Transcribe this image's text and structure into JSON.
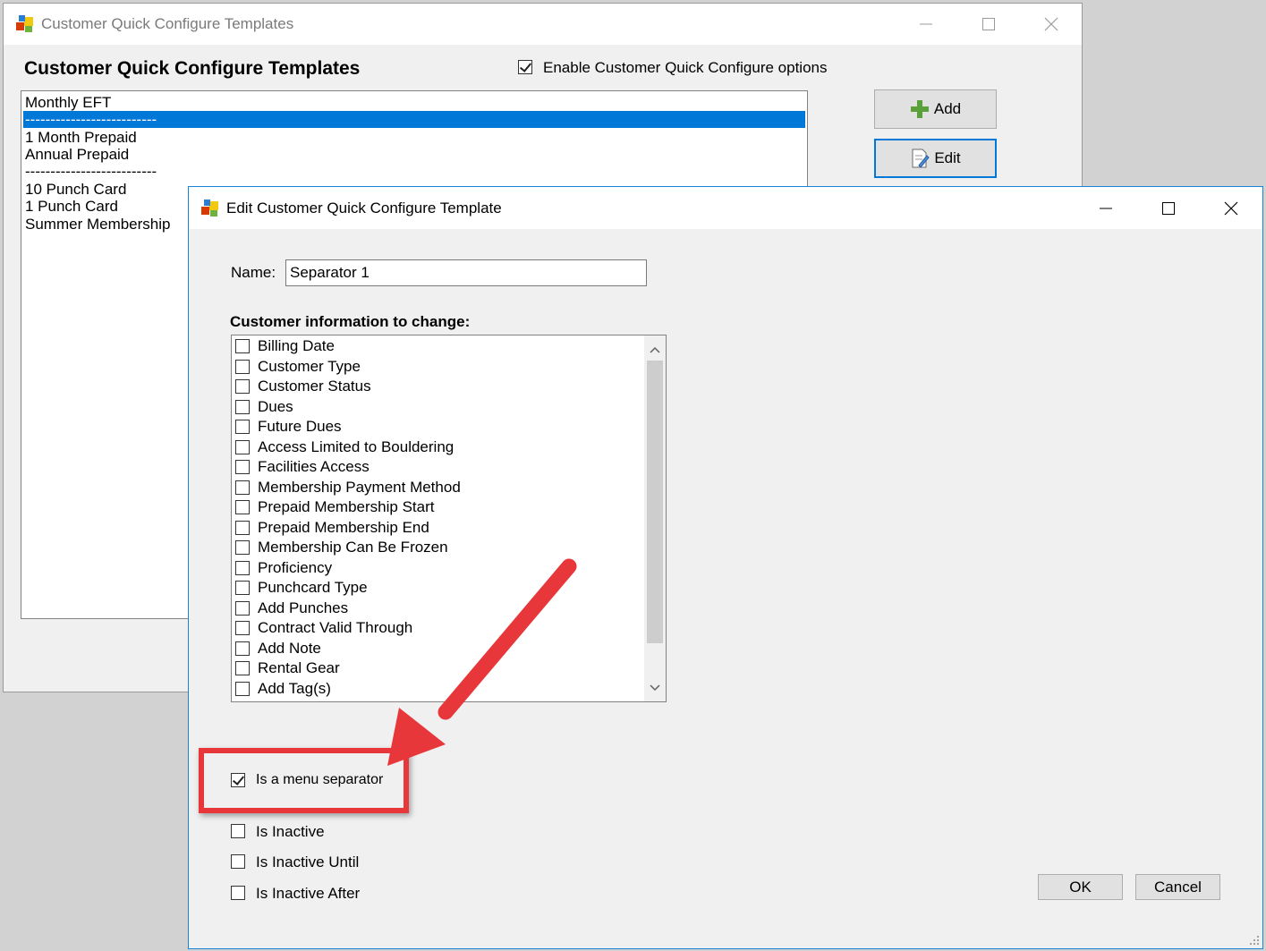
{
  "back_window": {
    "title": "Customer Quick Configure Templates",
    "heading": "Customer Quick Configure Templates",
    "enable_option": {
      "label": "Enable Customer Quick Configure options",
      "checked": true
    },
    "template_list": [
      {
        "text": "Monthly EFT",
        "selected": false
      },
      {
        "text": "--------------------------",
        "selected": true
      },
      {
        "text": "1 Month Prepaid",
        "selected": false
      },
      {
        "text": "Annual Prepaid",
        "selected": false
      },
      {
        "text": "--------------------------",
        "selected": false
      },
      {
        "text": "10 Punch Card",
        "selected": false
      },
      {
        "text": "1 Punch Card",
        "selected": false
      },
      {
        "text": "Summer Membership",
        "selected": false
      }
    ],
    "add_label": "Add",
    "edit_label": "Edit"
  },
  "dialog": {
    "title": "Edit Customer Quick Configure Template",
    "name_label": "Name:",
    "name_value": "Separator 1",
    "customer_info_label": "Customer information to change:",
    "customer_info_items": [
      {
        "label": "Billing Date",
        "checked": false
      },
      {
        "label": "Customer Type",
        "checked": false
      },
      {
        "label": "Customer Status",
        "checked": false
      },
      {
        "label": "Dues",
        "checked": false
      },
      {
        "label": "Future Dues",
        "checked": false
      },
      {
        "label": "Access Limited to Bouldering",
        "checked": false
      },
      {
        "label": "Facilities  Access",
        "checked": false
      },
      {
        "label": "Membership Payment Method",
        "checked": false
      },
      {
        "label": "Prepaid Membership Start",
        "checked": false
      },
      {
        "label": "Prepaid Membership End",
        "checked": false
      },
      {
        "label": "Membership Can Be Frozen",
        "checked": false
      },
      {
        "label": "Proficiency",
        "checked": false
      },
      {
        "label": "Punchcard Type",
        "checked": false
      },
      {
        "label": "Add Punches",
        "checked": false
      },
      {
        "label": "Contract Valid Through",
        "checked": false
      },
      {
        "label": "Add Note",
        "checked": false
      },
      {
        "label": "Rental Gear",
        "checked": false
      },
      {
        "label": "Add Tag(s)",
        "checked": false
      }
    ],
    "menu_separator": {
      "label": "Is a menu separator",
      "checked": true
    },
    "is_inactive": {
      "label": "Is Inactive",
      "checked": false
    },
    "is_inactive_until": {
      "label": "Is Inactive Until",
      "checked": false
    },
    "is_inactive_after": {
      "label": "Is Inactive After",
      "checked": false
    },
    "ok_label": "OK",
    "cancel_label": "Cancel"
  },
  "colors": {
    "selection": "#0078d7",
    "annotation": "#e8373a",
    "focus_border": "#0078d7"
  }
}
